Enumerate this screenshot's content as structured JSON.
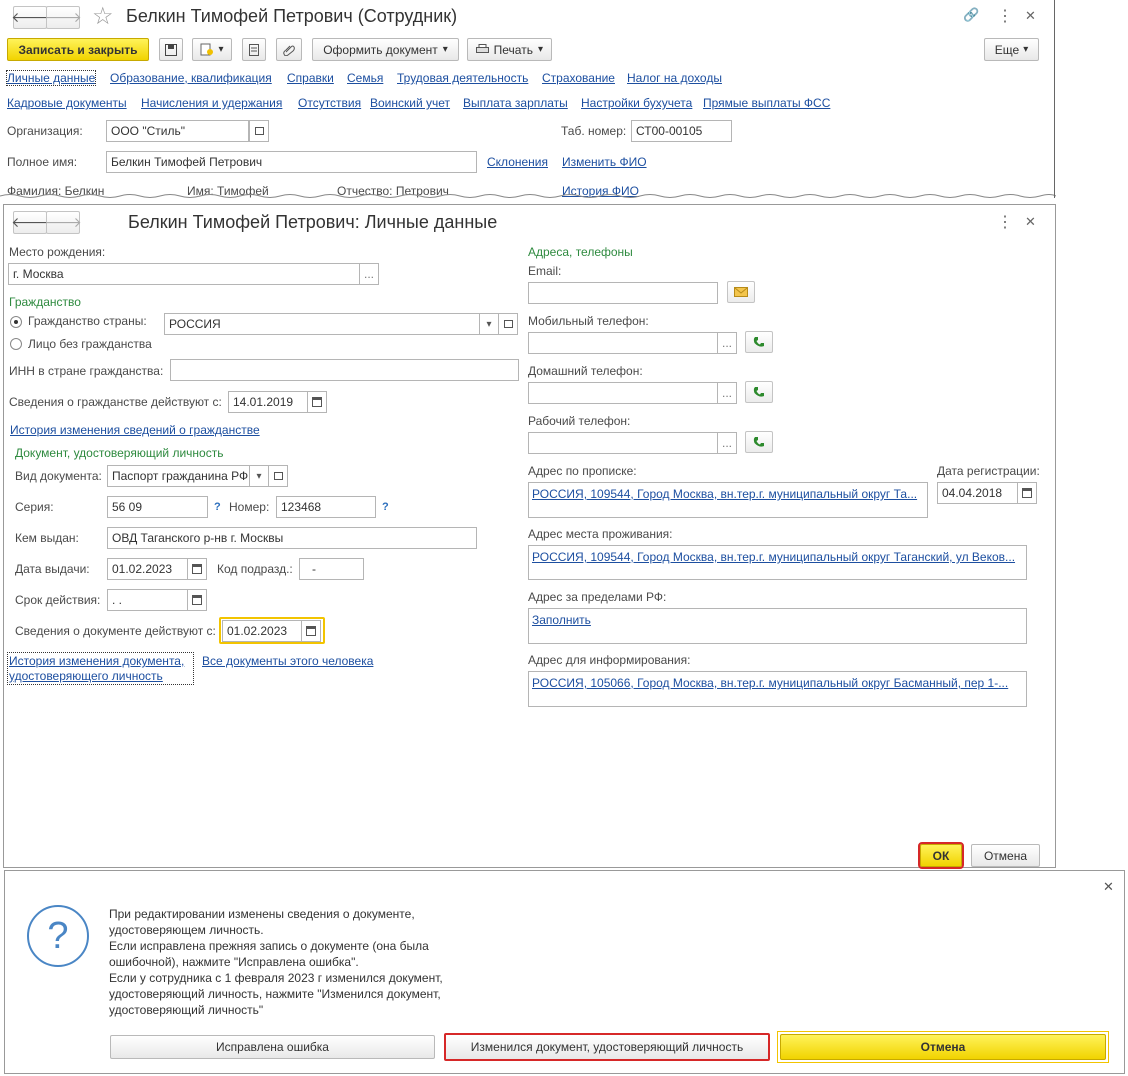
{
  "employee_window": {
    "title": "Белкин Тимофей Петрович (Сотрудник)",
    "toolbar": {
      "save_close": "Записать и закрыть",
      "create_document": "Оформить документ",
      "print": "Печать",
      "more": "Еще"
    },
    "tabs_row1": [
      "Личные данные",
      "Образование, квалификация",
      "Справки",
      "Семья",
      "Трудовая деятельность",
      "Страхование",
      "Налог на доходы"
    ],
    "tabs_row2": [
      "Кадровые документы",
      "Начисления и удержания",
      "Отсутствия",
      "Воинский учет",
      "Выплата зарплаты",
      "Настройки бухучета",
      "Прямые выплаты ФСС"
    ],
    "organization_label": "Организация:",
    "organization_value": "ООО \"Стиль\"",
    "tab_number_label": "Таб. номер:",
    "tab_number_value": "СТ00-00105",
    "full_name_label": "Полное имя:",
    "full_name_value": "Белкин Тимофей Петрович",
    "declension_link": "Склонения",
    "change_name_link": "Изменить ФИО",
    "surname_text": "Фамилия: Белкин",
    "name_text": "Имя: Тимофей",
    "patronymic_text": "Отчество: Петрович",
    "name_history_link": "История ФИО"
  },
  "personal_window": {
    "title": "Белкин Тимофей Петрович: Личные данные",
    "birthplace_label": "Место рождения:",
    "birthplace_value": "г. Москва",
    "citizenship_header": "Гражданство",
    "citizenship_country_label": "Гражданство страны:",
    "citizenship_country_value": "РОССИЯ",
    "stateless_label": "Лицо без гражданства",
    "inn_label": "ИНН в стране гражданства:",
    "inn_value": "",
    "citizenship_from_label": "Сведения о гражданстве действуют с:",
    "citizenship_from_value": "14.01.2019",
    "citizenship_history_link": "История изменения сведений о гражданстве",
    "id_doc_header": "Документ, удостоверяющий личность",
    "doc_type_label": "Вид документа:",
    "doc_type_value": "Паспорт гражданина РФ",
    "series_label": "Серия:",
    "series_value": "56 09",
    "number_label": "Номер:",
    "number_value": "123468",
    "help_mark": "?",
    "issued_by_label": "Кем выдан:",
    "issued_by_value": "ОВД Таганского р-нв г. Москвы",
    "issue_date_label": "Дата выдачи:",
    "issue_date_value": "01.02.2023",
    "dept_code_label": "Код подразд.:",
    "dept_code_value": "-",
    "valid_until_label": "Срок действия:",
    "valid_until_value": " .  .",
    "doc_from_label": "Сведения о документе действуют с:",
    "doc_from_value": "01.02.2023",
    "doc_history_link_1": "История изменения документа,",
    "doc_history_link_2": "удостоверяющего личность",
    "all_docs_link": "Все документы этого человека",
    "contacts_header": "Адреса, телефоны",
    "email_label": "Email:",
    "mobile_label": "Мобильный телефон:",
    "home_phone_label": "Домашний телефон:",
    "work_phone_label": "Рабочий телефон:",
    "reg_address_label": "Адрес по прописке:",
    "reg_address_value": "РОССИЯ, 109544, Город Москва, вн.тер.г. муниципальный округ Та...",
    "reg_date_label": "Дата регистрации:",
    "reg_date_value": "04.04.2018",
    "residence_label": "Адрес места проживания:",
    "residence_value": "РОССИЯ, 109544, Город Москва, вн.тер.г. муниципальный округ Таганский, ул Веков...",
    "abroad_label": "Адрес за пределами РФ:",
    "abroad_value": "Заполнить",
    "info_address_label": "Адрес для информирования:",
    "info_address_value": "РОССИЯ, 105066, Город Москва, вн.тер.г. муниципальный округ Басманный, пер 1-...",
    "ok_label": "ОК",
    "cancel_label": "Отмена"
  },
  "dialog": {
    "lines": [
      "При редактировании изменены сведения о документе,",
      "удостоверяющем личность.",
      "Если исправлена прежняя запись о документе (она была",
      "ошибочной), нажмите \"Исправлена ошибка\".",
      "Если у сотрудника с 1 февраля 2023 г изменился документ,",
      "удостоверяющий личность, нажмите \"Изменился документ,",
      "удостоверяющий личность\""
    ],
    "btn_fixed_error": "Исправлена ошибка",
    "btn_doc_changed": "Изменился документ, удостоверяющий личность",
    "btn_cancel": "Отмена",
    "question_mark": "?"
  },
  "glyphs": {
    "back": "🡐",
    "forward": "🡒",
    "star": "☆",
    "link": "🔗",
    "kebab": "⋮",
    "close": "✕",
    "chevron": "▾",
    "ellipsis": "..."
  },
  "colors": {
    "yellow": "#f5dc00",
    "link": "#1d4fa0",
    "green": "#2e8a3f",
    "red": "#d62828"
  }
}
